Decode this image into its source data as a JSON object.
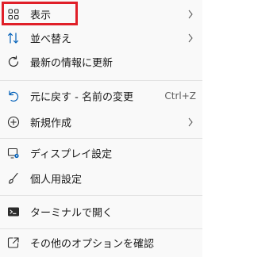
{
  "menu": {
    "items": [
      {
        "label": "表示",
        "icon": "view-grid-icon",
        "has_submenu": true
      },
      {
        "label": "並べ替え",
        "icon": "sort-icon",
        "has_submenu": true
      },
      {
        "label": "最新の情報に更新",
        "icon": "refresh-icon",
        "has_submenu": false
      },
      {
        "label": "元に戻す - 名前の変更",
        "icon": "undo-icon",
        "shortcut": "Ctrl+Z"
      },
      {
        "label": "新規作成",
        "icon": "new-plus-icon",
        "has_submenu": true
      },
      {
        "label": "ディスプレイ設定",
        "icon": "display-settings-icon",
        "has_submenu": false
      },
      {
        "label": "個人用設定",
        "icon": "brush-icon",
        "has_submenu": false
      },
      {
        "label": "ターミナルで開く",
        "icon": "terminal-icon",
        "has_submenu": false
      },
      {
        "label": "その他のオプションを確認",
        "icon": "share-more-icon",
        "has_submenu": false
      }
    ]
  },
  "annotation": {
    "highlight_color": "#e01f28"
  },
  "colors": {
    "accent": "#005fb8",
    "text": "#1a1a1a",
    "separator": "#e3e3e3"
  }
}
